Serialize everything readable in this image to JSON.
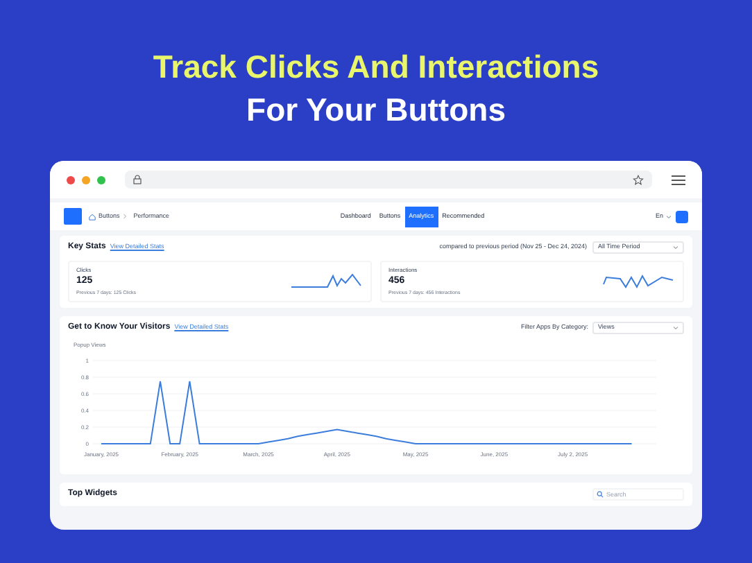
{
  "headline": {
    "line_1": "Track Clicks And Interactions",
    "line_2": "For Your Buttons"
  },
  "nav": {
    "breadcrumb": [
      "Buttons",
      "Performance"
    ],
    "tabs": [
      {
        "label": "Dashboard",
        "selected": false
      },
      {
        "label": "Buttons",
        "selected": false
      },
      {
        "label": "Analytics",
        "selected": true
      },
      {
        "label": "Recommended",
        "selected": false
      }
    ],
    "language": "En"
  },
  "key_stats": {
    "title": "Key Stats",
    "link": "View Detailed Stats",
    "comparison": "compared to previous period (Nov 25 - Dec 24, 2024)",
    "period": "All Time Period",
    "cards": [
      {
        "label": "Clicks",
        "value": "125",
        "note": "Previous 7 days: 125 Clicks"
      },
      {
        "label": "Interactions",
        "value": "456",
        "note": "Previous 7 days: 456 Interactions"
      }
    ]
  },
  "visitors": {
    "title": "Get to Know Your Visitors",
    "link": "View Detailed Stats",
    "filter_label": "Filter Apps By Category:",
    "filter_value": "Views",
    "chart_data": {
      "type": "line",
      "ylabel": "Popup Views",
      "categories": [
        "January, 2025",
        null,
        null,
        null,
        null,
        null,
        null,
        null,
        "February, 2025",
        null,
        null,
        null,
        null,
        null,
        null,
        null,
        "March, 2025",
        null,
        null,
        null,
        null,
        null,
        null,
        null,
        "April, 2025",
        null,
        null,
        null,
        null,
        null,
        null,
        null,
        "May, 2025",
        null,
        null,
        null,
        null,
        null,
        null,
        null,
        "June, 2025",
        null,
        null,
        null,
        null,
        null,
        null,
        null,
        "July 2, 2025",
        null,
        null,
        null,
        null,
        null,
        null
      ],
      "series": [
        {
          "color": "#3b7ddd",
          "values": [
            0,
            0,
            0,
            0,
            0,
            0,
            0.75,
            0,
            0,
            0.75,
            0,
            0,
            0,
            0,
            0,
            0,
            0,
            0.02,
            0.04,
            0.06,
            0.09,
            0.11,
            0.13,
            0.15,
            0.17,
            0.15,
            0.13,
            0.11,
            0.09,
            0.06,
            0.04,
            0.02,
            0,
            0,
            0,
            0,
            0,
            0,
            0,
            0,
            0,
            0,
            0,
            0,
            0,
            0,
            0,
            0,
            0,
            0,
            0,
            0,
            0,
            0,
            0
          ]
        }
      ],
      "ylim": [
        0,
        1
      ],
      "yticks": [
        0,
        0.2,
        0.4,
        0.6,
        0.8,
        1
      ],
      "grid": true
    }
  },
  "top_widgets": {
    "title": "Top Widgets",
    "search_placeholder": "Search"
  }
}
